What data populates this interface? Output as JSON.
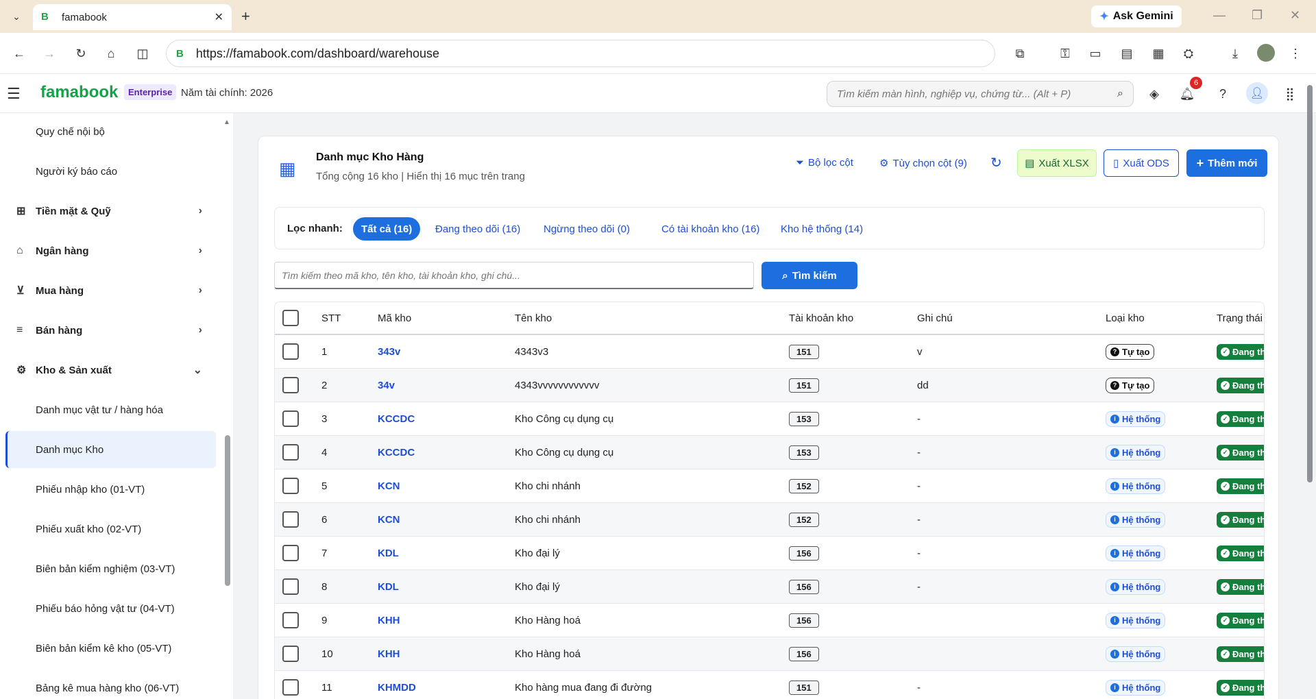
{
  "browser": {
    "tab_title": "famabook",
    "favicon": "B",
    "url": "https://famabook.com/dashboard/warehouse",
    "ask_gemini": "Ask Gemini"
  },
  "header": {
    "logo": "famabook",
    "plan_badge": "Enterprise",
    "fiscal_year": "Năm tài chính: 2026",
    "search_placeholder": "Tìm kiếm màn hình, nghiệp vụ, chứng từ... (Alt + P)",
    "notification_count": "6"
  },
  "sidebar": {
    "items": [
      {
        "label": "Quy chế nội bộ",
        "type": "sub"
      },
      {
        "label": "Người ký báo cáo",
        "type": "sub"
      },
      {
        "label": "Tiền mặt & Quỹ",
        "type": "group",
        "icon": "cash-icon"
      },
      {
        "label": "Ngân hàng",
        "type": "group",
        "icon": "bank-icon"
      },
      {
        "label": "Mua hàng",
        "type": "group",
        "icon": "cart-icon"
      },
      {
        "label": "Bán hàng",
        "type": "group",
        "icon": "sales-icon"
      },
      {
        "label": "Kho & Sản xuất",
        "type": "group-open",
        "icon": "warehouse-icon"
      },
      {
        "label": "Danh mục vật tư / hàng hóa",
        "type": "sub"
      },
      {
        "label": "Danh mục Kho",
        "type": "sub-active"
      },
      {
        "label": "Phiếu nhập kho (01-VT)",
        "type": "sub"
      },
      {
        "label": "Phiếu xuất kho (02-VT)",
        "type": "sub"
      },
      {
        "label": "Biên bản kiểm nghiệm (03-VT)",
        "type": "sub"
      },
      {
        "label": "Phiếu báo hỏng vật tư (04-VT)",
        "type": "sub"
      },
      {
        "label": "Biên bản kiểm kê kho (05-VT)",
        "type": "sub"
      },
      {
        "label": "Bảng kê mua hàng kho (06-VT)",
        "type": "sub"
      }
    ]
  },
  "main": {
    "title": "Danh mục Kho Hàng",
    "subtitle": "Tổng cộng 16 kho | Hiển thị 16 mục trên trang",
    "actions": {
      "column_filter": "Bộ lọc cột",
      "column_options": "Tùy chọn cột (9)",
      "export_xlsx": "Xuất XLSX",
      "export_ods": "Xuất ODS",
      "add_new": "Thêm mới"
    },
    "quick_filter": {
      "label": "Lọc nhanh:",
      "chips": [
        "Tất cả (16)",
        "Đang theo dõi (16)",
        "Ngừng theo dõi (0)",
        "Có tài khoản kho (16)",
        "Kho hệ thống (14)"
      ]
    },
    "search": {
      "placeholder": "Tìm kiếm theo mã kho, tên kho, tài khoản kho, ghi chú...",
      "button": "Tìm kiếm"
    },
    "table": {
      "headers": [
        "STT",
        "Mã kho",
        "Tên kho",
        "Tài khoản kho",
        "Ghi chú",
        "Loại kho",
        "Trạng thái"
      ],
      "rows": [
        {
          "stt": "1",
          "code": "343v",
          "name": "4343v3",
          "account": "151",
          "note": "v",
          "type": "Tự tạo",
          "status": "Đang th"
        },
        {
          "stt": "2",
          "code": "34v",
          "name": "4343vvvvvvvvvvvv",
          "account": "151",
          "note": "dd",
          "type": "Tự tạo",
          "status": "Đang th"
        },
        {
          "stt": "3",
          "code": "KCCDC",
          "name": "Kho Công cụ dụng cụ",
          "account": "153",
          "note": "-",
          "type": "Hệ thống",
          "status": "Đang th"
        },
        {
          "stt": "4",
          "code": "KCCDC",
          "name": "Kho Công cụ dụng cụ",
          "account": "153",
          "note": "-",
          "type": "Hệ thống",
          "status": "Đang th"
        },
        {
          "stt": "5",
          "code": "KCN",
          "name": "Kho chi nhánh",
          "account": "152",
          "note": "-",
          "type": "Hệ thống",
          "status": "Đang th"
        },
        {
          "stt": "6",
          "code": "KCN",
          "name": "Kho chi nhánh",
          "account": "152",
          "note": "-",
          "type": "Hệ thống",
          "status": "Đang th"
        },
        {
          "stt": "7",
          "code": "KDL",
          "name": "Kho đại lý",
          "account": "156",
          "note": "-",
          "type": "Hệ thống",
          "status": "Đang th"
        },
        {
          "stt": "8",
          "code": "KDL",
          "name": "Kho đại lý",
          "account": "156",
          "note": "-",
          "type": "Hệ thống",
          "status": "Đang th"
        },
        {
          "stt": "9",
          "code": "KHH",
          "name": "Kho Hàng hoá",
          "account": "156",
          "note": "",
          "type": "Hệ thống",
          "status": "Đang th"
        },
        {
          "stt": "10",
          "code": "KHH",
          "name": "Kho Hàng hoá",
          "account": "156",
          "note": "",
          "type": "Hệ thống",
          "status": "Đang th"
        },
        {
          "stt": "11",
          "code": "KHMDD",
          "name": "Kho hàng mua đang đi đường",
          "account": "151",
          "note": "-",
          "type": "Hệ thống",
          "status": "Đang th"
        }
      ]
    }
  }
}
